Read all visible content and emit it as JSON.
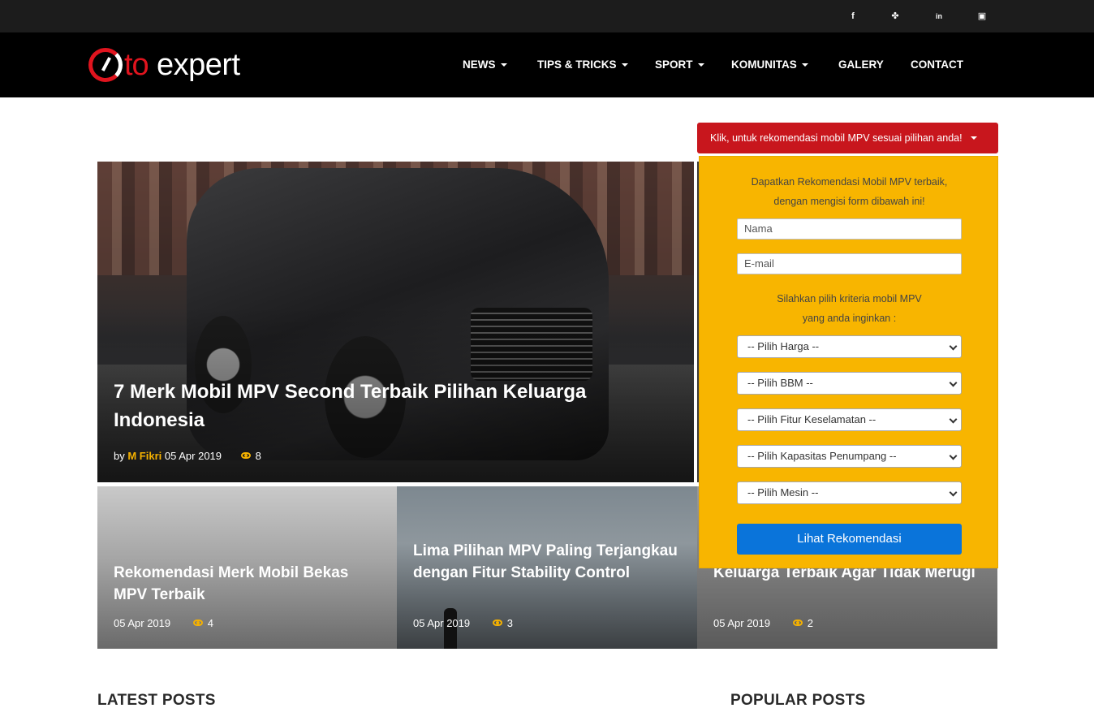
{
  "social": {
    "facebook_glyph": "f",
    "twitter_glyph": "✤",
    "linkedin_glyph": "in",
    "instagram_glyph": "▣"
  },
  "brand": {
    "logo_o": "O",
    "logo_to": "to",
    "logo_expert": "expert"
  },
  "nav": {
    "news": "NEWS",
    "tips": "TIPS & TRICKS",
    "sport": "SPORT",
    "komunitas": "KOMUNITAS",
    "galery": "GALERY",
    "contact": "CONTACT"
  },
  "recommend_toggle": "Klik, untuk rekomendasi mobil MPV sesuai pilihan anda!",
  "hero": {
    "title": "7 Merk Mobil MPV Second Terbaik Pilihan Keluarga Indonesia",
    "by": "by",
    "author": "M Fikri",
    "date": "05 Apr 2019",
    "views": "8"
  },
  "cards": [
    {
      "title": "Rekomendasi Merk Mobil Bekas MPV Terbaik",
      "date": "05 Apr 2019",
      "views": "4"
    },
    {
      "title": "Lima Pilihan MPV Paling Terjangkau dengan Fitur Stability Control",
      "date": "05 Apr 2019",
      "views": "3"
    },
    {
      "title": "Keluarga Terbaik Agar Tidak Merugi",
      "date": "05 Apr 2019",
      "views": "2"
    }
  ],
  "form": {
    "intro_line1": "Dapatkan Rekomendasi Mobil MPV terbaik,",
    "intro_line2": "dengan mengisi form dibawah ini!",
    "name_placeholder": "Nama",
    "email_placeholder": "E-mail",
    "criteria_line1": "Silahkan pilih kriteria mobil MPV",
    "criteria_line2": "yang anda inginkan :",
    "harga": "-- Pilih Harga --",
    "bbm": "-- Pilih BBM --",
    "keselamatan": "-- Pilih Fitur Keselamatan --",
    "kapasitas": "-- Pilih Kapasitas Penumpang --",
    "mesin": "-- Pilih Mesin --",
    "submit": "Lihat Rekomendasi"
  },
  "sections": {
    "latest": "LATEST POSTS",
    "popular": "POPULAR POSTS"
  },
  "colors": {
    "brand_red": "#c8161d",
    "accent_yellow": "#f8b500",
    "button_blue": "#0a74da",
    "header_black": "#000000"
  }
}
